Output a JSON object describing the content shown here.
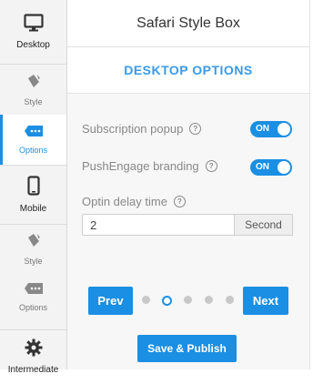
{
  "sidebar": {
    "items": [
      {
        "label": "Desktop",
        "icon": "monitor-icon"
      },
      {
        "label": "Style",
        "icon": "paint-bucket-icon"
      },
      {
        "label": "Options",
        "icon": "options-tag-icon",
        "active": true
      },
      {
        "label": "Mobile",
        "icon": "mobile-phone-icon"
      },
      {
        "label": "Style",
        "icon": "paint-bucket-icon"
      },
      {
        "label": "Options",
        "icon": "options-tag-icon"
      },
      {
        "label": "Intermediate",
        "icon": "gear-icon"
      }
    ]
  },
  "header": {
    "title": "Safari Style Box"
  },
  "section": {
    "title": "DESKTOP OPTIONS"
  },
  "options": {
    "subscription_popup": {
      "label": "Subscription popup",
      "state": "ON"
    },
    "branding": {
      "label": "PushEngage branding",
      "state": "ON"
    },
    "optin_delay": {
      "label": "Optin delay time",
      "value": "2",
      "unit": "Second"
    }
  },
  "pager": {
    "prev_label": "Prev",
    "next_label": "Next",
    "total_pages": 5,
    "current_page": 1
  },
  "publish_label": "Save & Publish",
  "colors": {
    "accent": "#1a8fe3",
    "section_title": "#3a9ae8",
    "sidebar_bg": "#f3f3f3"
  }
}
